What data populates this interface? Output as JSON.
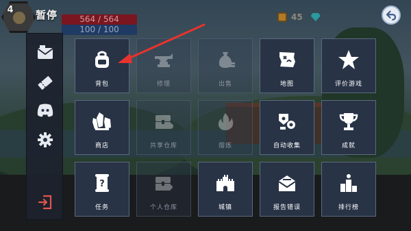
{
  "hud": {
    "level": "4",
    "title": "暂停",
    "hp": "564 / 564",
    "mp": "100 / 100",
    "coins": "45"
  },
  "sidebar": {
    "items": [
      {
        "name": "mail-icon"
      },
      {
        "name": "ticket-icon"
      },
      {
        "name": "discord-icon"
      },
      {
        "name": "settings-gear-icon"
      },
      {
        "name": "exit-icon"
      }
    ]
  },
  "tiles": [
    {
      "label": "背包",
      "icon": "backpack-icon",
      "enabled": true
    },
    {
      "label": "修理",
      "icon": "anvil-icon",
      "enabled": false
    },
    {
      "label": "出售",
      "icon": "money-bag-icon",
      "enabled": false
    },
    {
      "label": "地图",
      "icon": "map-icon",
      "enabled": true
    },
    {
      "label": "评价游戏",
      "icon": "star-icon",
      "enabled": true
    },
    {
      "label": "商店",
      "icon": "crystals-icon",
      "enabled": true
    },
    {
      "label": "共享仓库",
      "icon": "shared-chest-icon",
      "enabled": false
    },
    {
      "label": "熔炼",
      "icon": "flame-icon",
      "enabled": false
    },
    {
      "label": "自动收集",
      "icon": "auto-collect-icon",
      "enabled": true
    },
    {
      "label": "成就",
      "icon": "trophy-icon",
      "enabled": true
    },
    {
      "label": "任务",
      "icon": "quest-scroll-icon",
      "enabled": true
    },
    {
      "label": "个人仓库",
      "icon": "personal-chest-icon",
      "enabled": false
    },
    {
      "label": "城镇",
      "icon": "castle-icon",
      "enabled": true
    },
    {
      "label": "报告错误",
      "icon": "report-mail-icon",
      "enabled": true
    },
    {
      "label": "排行榜",
      "icon": "leaderboard-icon",
      "enabled": true
    }
  ],
  "colors": {
    "tile_bg": "#283346",
    "hp_bar": "#7a1620",
    "mp_bar": "#1f3a63",
    "exit_red": "#e2564f",
    "arrow_red": "#e8332e"
  }
}
